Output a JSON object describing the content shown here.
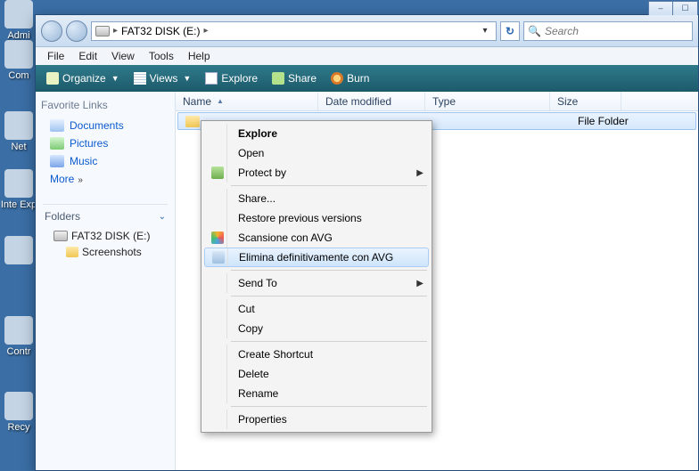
{
  "desktop": {
    "icons": [
      "Admi",
      "",
      "Com",
      "Net",
      "Inte Exp",
      "",
      "Contr",
      "Recy",
      ""
    ]
  },
  "window": {
    "controls": {
      "min": "–",
      "max": "☐"
    },
    "breadcrumb": {
      "drive_label": "FAT32 DISK (E:)",
      "sep1": "▸",
      "drop": "▾"
    },
    "refresh": "↻",
    "search": {
      "placeholder": "Search"
    }
  },
  "menubar": [
    "File",
    "Edit",
    "View",
    "Tools",
    "Help"
  ],
  "cmdbar": {
    "organize": "Organize",
    "views": "Views",
    "explore": "Explore",
    "share": "Share",
    "burn": "Burn"
  },
  "sidebar": {
    "fav_title": "Favorite Links",
    "links": {
      "documents": "Documents",
      "pictures": "Pictures",
      "music": "Music"
    },
    "more": "More",
    "folders_title": "Folders",
    "tree": {
      "drive": "FAT32 DISK (E:)",
      "child": "Screenshots"
    }
  },
  "columns": {
    "name": "Name",
    "date": "Date modified",
    "type": "Type",
    "size": "Size"
  },
  "rows": [
    {
      "name": "",
      "type": "File Folder"
    }
  ],
  "context_menu": {
    "explore": "Explore",
    "open": "Open",
    "protect_by": "Protect by",
    "share": "Share...",
    "restore": "Restore previous versions",
    "scan_avg": "Scansione con AVG",
    "shred_avg": "Elimina definitivamente con AVG",
    "send_to": "Send To",
    "cut": "Cut",
    "copy": "Copy",
    "create_shortcut": "Create Shortcut",
    "delete": "Delete",
    "rename": "Rename",
    "properties": "Properties"
  }
}
